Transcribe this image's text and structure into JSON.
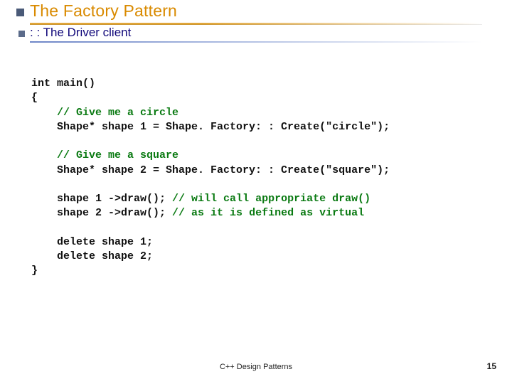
{
  "title": "The Factory Pattern",
  "subtitle": ": : The Driver client",
  "code": {
    "l1": "int main()",
    "l2": "{",
    "l3_indent": "    ",
    "l3_cmt": "// Give me a circle",
    "l4": "    Shape* shape 1 = Shape. Factory: : Create(\"circle\");",
    "l5_cmt": "// Give me a square",
    "l6": "    Shape* shape 2 = Shape. Factory: : Create(\"square\");",
    "l7a": "    shape 1 ->draw(); ",
    "l7b_cmt": "// will call appropriate draw()",
    "l8a": "    shape 2 ->draw(); ",
    "l8b_cmt": "// as it is defined as virtual",
    "l9": "    delete shape 1;",
    "l10": "    delete shape 2;",
    "l11": "}"
  },
  "footer_center": "C++ Design Patterns",
  "page_number": "15"
}
